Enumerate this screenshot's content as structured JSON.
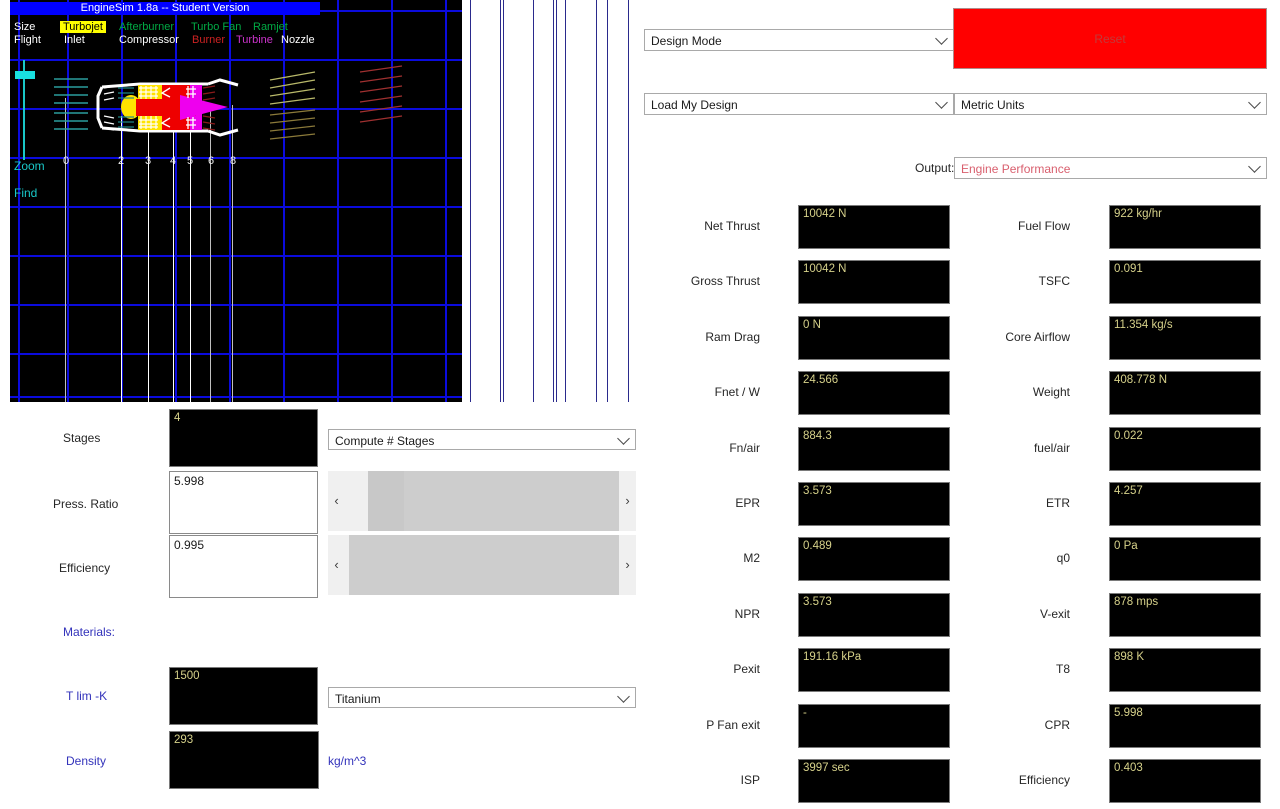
{
  "app": {
    "title": "EngineSim 1.8a -- Student Version"
  },
  "menu": {
    "row1": [
      {
        "label": "Size",
        "style": "white"
      },
      {
        "label": "Turbojet",
        "style": "sel"
      },
      {
        "label": "Afterburner",
        "style": "green"
      },
      {
        "label": "Turbo Fan",
        "style": "green"
      },
      {
        "label": "Ramjet",
        "style": "green"
      }
    ],
    "row2": [
      {
        "label": "Flight",
        "style": "white"
      },
      {
        "label": "Inlet",
        "style": "white"
      },
      {
        "label": "Compressor",
        "style": "white"
      },
      {
        "label": "Burner",
        "style": "red"
      },
      {
        "label": "Turbine",
        "style": "purple"
      },
      {
        "label": "Nozzle",
        "style": "white"
      }
    ]
  },
  "graphics": {
    "zoom_label": "Zoom",
    "find_label": "Find",
    "station_labels": [
      "0",
      "2",
      "3",
      "4",
      "5",
      "6",
      "8"
    ]
  },
  "controls": {
    "design_mode": "Design Mode",
    "load_design": "Load My Design",
    "units": "Metric Units",
    "reset_label": "Reset",
    "output_label": "Output:",
    "output_value": "Engine Performance"
  },
  "compressor": {
    "stages_label": "Stages",
    "stages_value": "4",
    "stages_mode": "Compute # Stages",
    "press_ratio_label": "Press. Ratio",
    "press_ratio_value": "5.998",
    "efficiency_label": "Efficiency",
    "efficiency_value": "0.995"
  },
  "materials": {
    "heading": "Materials:",
    "tlim_label": "T lim -K",
    "tlim_value": "1500",
    "material": "Titanium",
    "density_label": "Density",
    "density_value": "293",
    "density_units": "kg/m^3"
  },
  "performance": {
    "left": [
      {
        "label": "Net Thrust",
        "value": "10042 N"
      },
      {
        "label": "Gross Thrust",
        "value": "10042 N"
      },
      {
        "label": "Ram Drag",
        "value": "0 N"
      },
      {
        "label": "Fnet / W",
        "value": "24.566"
      },
      {
        "label": "Fn/air",
        "value": "884.3"
      },
      {
        "label": "EPR",
        "value": "3.573"
      },
      {
        "label": "M2",
        "value": "0.489"
      },
      {
        "label": "NPR",
        "value": "3.573"
      },
      {
        "label": "Pexit",
        "value": "191.16 kPa"
      },
      {
        "label": "P Fan exit",
        "value": "-"
      },
      {
        "label": "ISP",
        "value": "3997 sec"
      }
    ],
    "right": [
      {
        "label": "Fuel Flow",
        "value": "922 kg/hr"
      },
      {
        "label": "TSFC",
        "value": "0.091"
      },
      {
        "label": "Core Airflow",
        "value": "11.354 kg/s"
      },
      {
        "label": "Weight",
        "value": "408.778 N"
      },
      {
        "label": "fuel/air",
        "value": "0.022"
      },
      {
        "label": "ETR",
        "value": "4.257"
      },
      {
        "label": "q0",
        "value": "0 Pa"
      },
      {
        "label": "V-exit",
        "value": "878 mps"
      },
      {
        "label": "T8",
        "value": "898 K"
      },
      {
        "label": "CPR",
        "value": "5.998"
      },
      {
        "label": "Efficiency",
        "value": "0.403"
      }
    ]
  },
  "colors": {
    "titlebar": "#0000ff",
    "selected_menu": "#ffff00",
    "reset_button": "#ff0000",
    "grid": "#0b0bdd",
    "value_text": "#d6d18a",
    "accent_cyan": "#19c8c8",
    "material_blue": "#3333bb"
  }
}
